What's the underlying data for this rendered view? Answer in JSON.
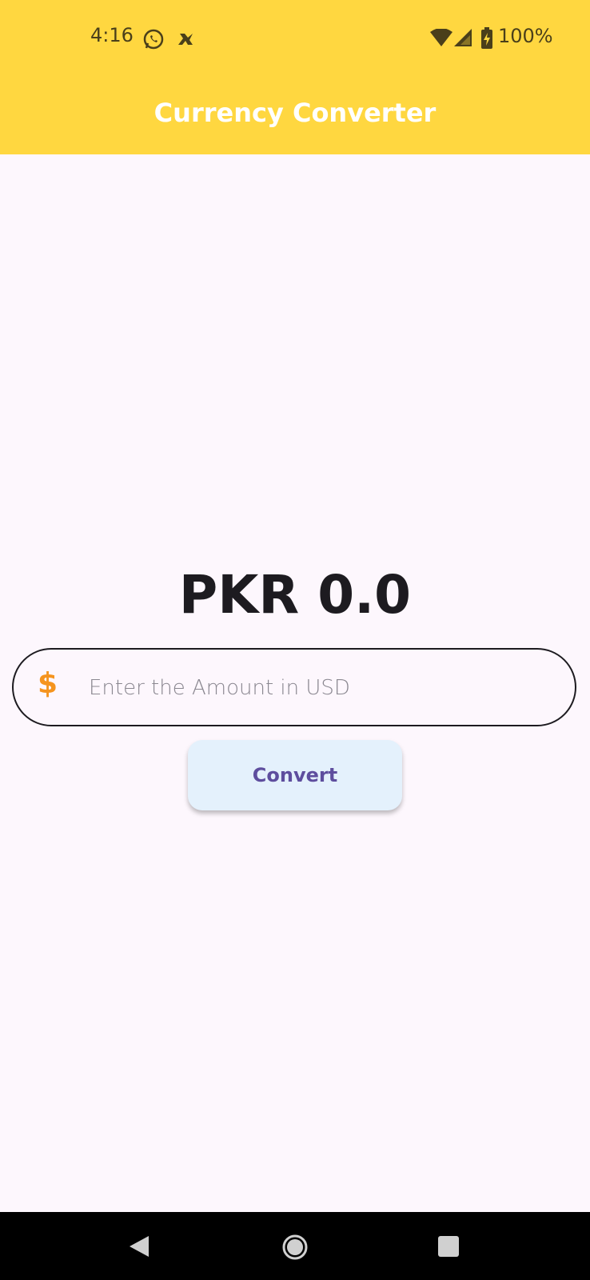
{
  "status_bar": {
    "time": "4:16",
    "battery_percent": "100%",
    "icons": [
      "whatsapp-icon",
      "notification-icon",
      "wifi-icon",
      "signal-icon",
      "battery-charging-icon"
    ]
  },
  "app_bar": {
    "title": "Currency Converter",
    "color": "#FFD740"
  },
  "main": {
    "result": "PKR 0.0",
    "amount_field": {
      "prefix_icon": "dollar-icon",
      "prefix_glyph": "$",
      "placeholder": "Enter the Amount in USD",
      "value": ""
    },
    "convert_button": {
      "label": "Convert"
    }
  },
  "nav_bar": {
    "buttons": [
      "back-icon",
      "home-icon",
      "recents-icon"
    ]
  },
  "colors": {
    "accent": "#FFD740",
    "background": "#FDF7FD",
    "button_bg": "#E4F1FC",
    "button_text": "#5E4E9E",
    "dollar_icon": "#F5941E"
  }
}
